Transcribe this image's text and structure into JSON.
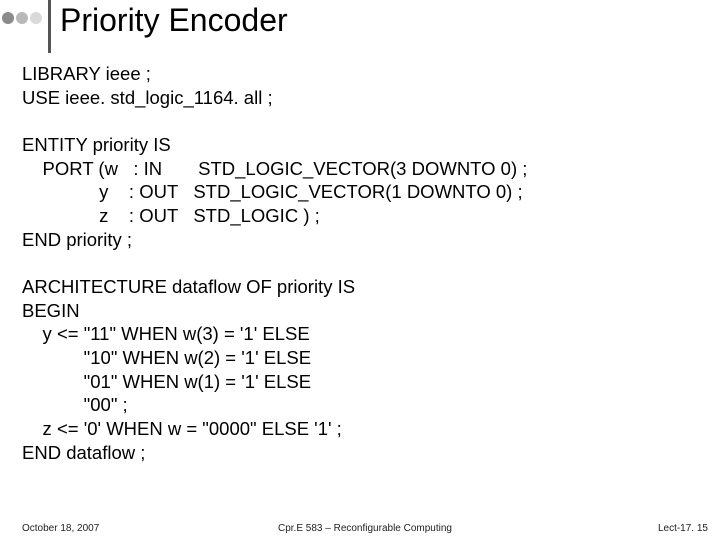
{
  "title": "Priority Encoder",
  "code": "LIBRARY ieee ;\nUSE ieee. std_logic_1164. all ;\n\nENTITY priority IS\n    PORT (w   : IN       STD_LOGIC_VECTOR(3 DOWNTO 0) ;\n               y    : OUT   STD_LOGIC_VECTOR(1 DOWNTO 0) ;\n               z    : OUT   STD_LOGIC ) ;\nEND priority ;\n\nARCHITECTURE dataflow OF priority IS\nBEGIN\n    y <= \"11\" WHEN w(3) = '1' ELSE\n            \"10\" WHEN w(2) = '1' ELSE\n            \"01\" WHEN w(1) = '1' ELSE\n            \"00\" ;\n    z <= '0' WHEN w = \"0000\" ELSE '1' ;\nEND dataflow ;",
  "footer": {
    "left": "October 18, 2007",
    "center": "Cpr.E 583 – Reconfigurable Computing",
    "right": "Lect-17. 15"
  }
}
